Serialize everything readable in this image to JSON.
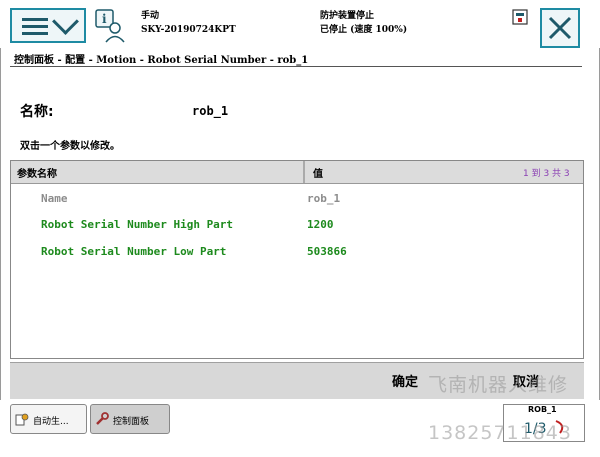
{
  "header": {
    "mode": "手动",
    "controller_name": "SKY-20190724KPT",
    "safety_status": "防护装置停止",
    "run_status": "已停止 (速度 100%)"
  },
  "breadcrumb": "控制面板 - 配置 - Motion - Robot Serial Number - rob_1",
  "instance": {
    "name_label": "名称:",
    "name_value": "rob_1"
  },
  "hint": "双击一个参数以修改。",
  "table": {
    "col_param": "参数名称",
    "col_value": "值",
    "pager": "1 到 3 共 3",
    "rows": [
      {
        "name": "Name",
        "value": "rob_1",
        "state": "disabled"
      },
      {
        "name": "Robot Serial Number High Part",
        "value": "1200",
        "state": "editable"
      },
      {
        "name": "Robot Serial Number Low Part",
        "value": "503866",
        "state": "editable"
      }
    ]
  },
  "actions": {
    "ok": "确定",
    "cancel": "取消"
  },
  "taskbar": {
    "auto_task": "自动生...",
    "control_panel_task": "控制面板",
    "mech_unit": "ROB_1",
    "mech_unit_readout": "1/3"
  },
  "watermark": {
    "line1": "飞南机器人维修",
    "line2": "13825711843"
  },
  "colors": {
    "accent": "#1e8ba3",
    "editable": "#1d8a1d",
    "disabled": "#8c8c8c",
    "pager": "#8a3fb3"
  }
}
